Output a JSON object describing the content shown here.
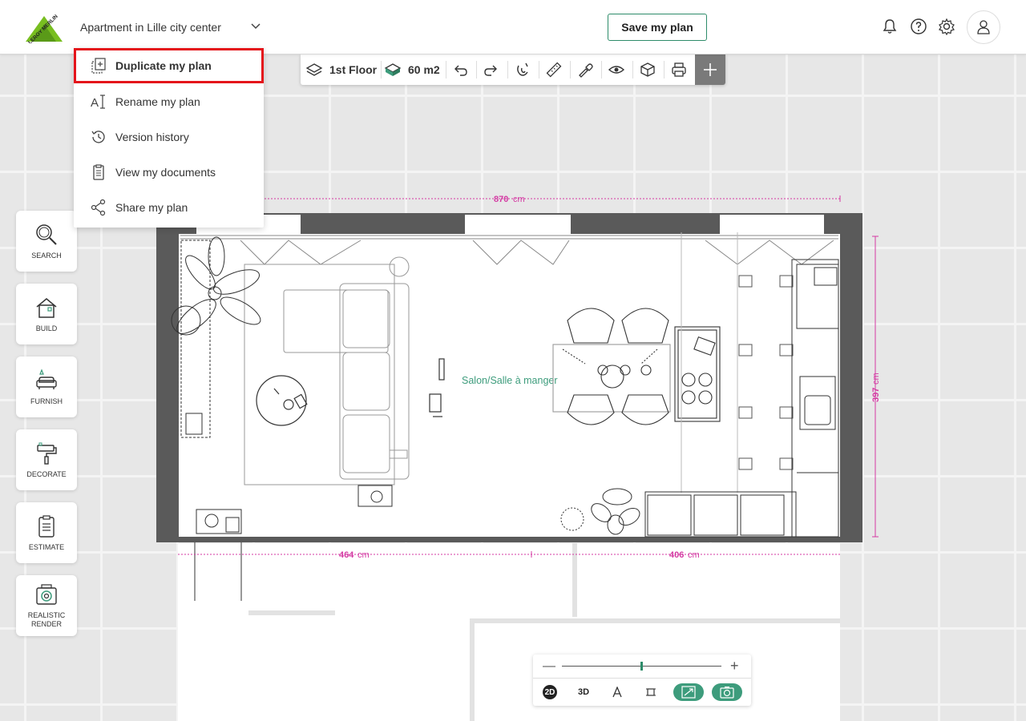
{
  "header": {
    "plan_name": "Apartment in Lille city center",
    "save_label": "Save my plan",
    "logo_text": "LEROY MERLIN"
  },
  "menu": {
    "items": [
      {
        "label": "Duplicate my plan",
        "icon": "duplicate-icon",
        "highlighted": true
      },
      {
        "label": "Rename my plan",
        "icon": "rename-icon"
      },
      {
        "label": "Version history",
        "icon": "history-icon"
      },
      {
        "label": "View my documents",
        "icon": "documents-icon"
      },
      {
        "label": "Share my plan",
        "icon": "share-icon"
      }
    ]
  },
  "toolbar": {
    "floor_label": "1st Floor",
    "area_label": "60 m2"
  },
  "sidebar": {
    "items": [
      {
        "label": "SEARCH",
        "icon": "search-icon"
      },
      {
        "label": "BUILD",
        "icon": "house-icon"
      },
      {
        "label": "FURNISH",
        "icon": "sofa-icon"
      },
      {
        "label": "DECORATE",
        "icon": "paint-roller-icon"
      },
      {
        "label": "ESTIMATE",
        "icon": "clipboard-icon"
      },
      {
        "label": "REALISTIC RENDER",
        "icon": "camera-icon"
      }
    ]
  },
  "plan": {
    "room_label": "Salon/Salle à manger",
    "dim_width": "870",
    "dim_left": "464",
    "dim_right": "406",
    "dim_height": "397",
    "unit": "cm"
  },
  "view_controls": {
    "view_2d": "2D",
    "view_3d": "3D"
  },
  "colors": {
    "accent": "#2e8c6a",
    "highlight": "#e4141b",
    "dimension": "#d43aa3"
  }
}
